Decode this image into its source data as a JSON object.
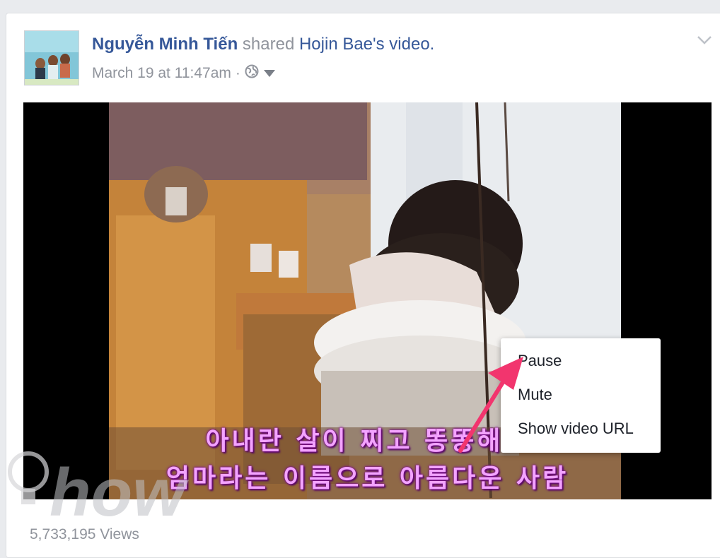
{
  "post": {
    "author_name": "Nguyễn Minh Tiến",
    "action_text": "shared",
    "shared_from_name": "Hojin Bae",
    "possessive": "'s",
    "object_text": "video.",
    "timestamp": "March 19 at 11:47am",
    "separator": "·",
    "privacy_icon": "globe-icon",
    "menu_icon": "chevron-down-icon"
  },
  "video": {
    "subtitle_line1": "아내란 살이 찌고 똥똥해도",
    "subtitle_line2": "엄마라는 이름으로 아름다운 사람",
    "context_menu": [
      "Pause",
      "Mute",
      "Show video URL"
    ]
  },
  "stats": {
    "views": "5,733,195 Views"
  },
  "watermark": {
    "text": "how"
  },
  "colors": {
    "link": "#365899",
    "meta_gray": "#90949c",
    "arrow": "#f2356e",
    "subtitle": "#f3a3ff"
  }
}
